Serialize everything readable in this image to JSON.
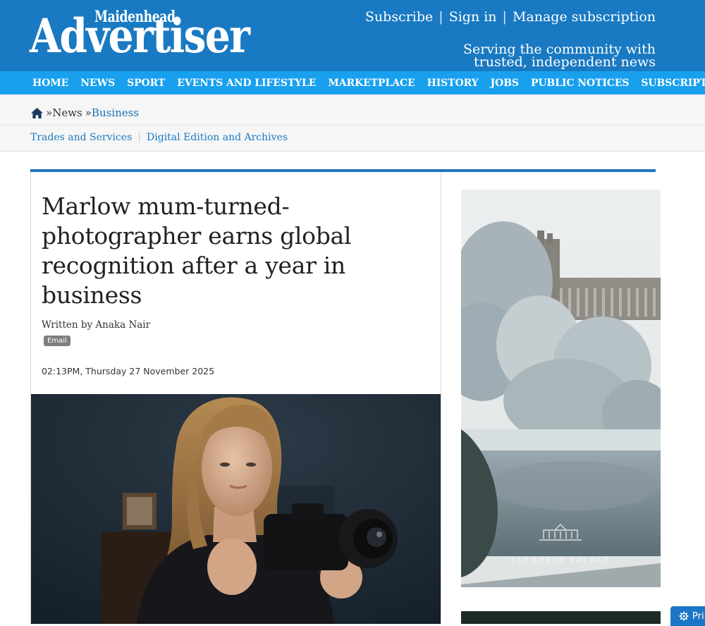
{
  "site": {
    "logo_top": "Maidenhead",
    "logo_main": "Advertiser",
    "account_links": [
      "Subscribe",
      "Sign in",
      "Manage subscription"
    ],
    "separator": "|",
    "tagline": "Serving the community with trusted, independent news"
  },
  "nav": {
    "items": [
      "HOME",
      "NEWS",
      "SPORT",
      "EVENTS AND LIFESTYLE",
      "MARKETPLACE",
      "HISTORY",
      "JOBS",
      "PUBLIC NOTICES",
      "SUBSCRIPTIONS"
    ]
  },
  "breadcrumb": {
    "sep": "»",
    "news": "News",
    "current": "Business"
  },
  "subnav": {
    "items": [
      "Trades and Services",
      "Digital Edition and Archives"
    ],
    "separator": "|"
  },
  "article": {
    "headline": "Marlow mum-turned-photographer earns global recognition after a year in business",
    "byline": "Written by Anaka Nair",
    "email_label": "Email",
    "date": "02:13PM, Thursday 27 November 2025"
  },
  "ad": {
    "brand": "BLENHEIM PALACE"
  },
  "privacy": {
    "label": "Pri"
  },
  "colors": {
    "masthead": "#1979c2",
    "nav": "#18a0ee",
    "accent_line": "#1d74bd",
    "link": "#1a79c2"
  },
  "icons": [
    "home-icon",
    "gear-icon"
  ]
}
